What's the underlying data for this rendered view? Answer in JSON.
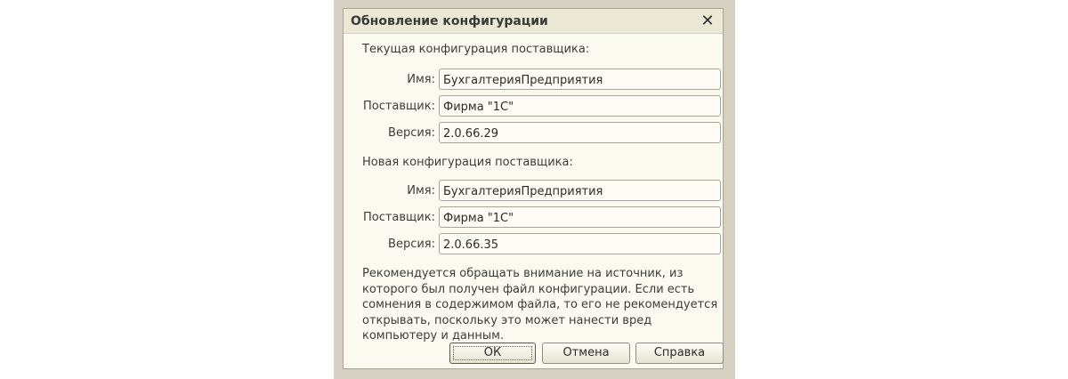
{
  "dialog": {
    "title": "Обновление конфигурации",
    "close_glyph": "✕"
  },
  "current": {
    "heading": "Текущая конфигурация поставщика:",
    "name_label": "Имя:",
    "name_value": "БухгалтерияПредприятия",
    "vendor_label": "Поставщик:",
    "vendor_value": "Фирма \"1С\"",
    "version_label": "Версия:",
    "version_value": "2.0.66.29"
  },
  "new": {
    "heading": "Новая конфигурация поставщика:",
    "name_label": "Имя:",
    "name_value": "БухгалтерияПредприятия",
    "vendor_label": "Поставщик:",
    "vendor_value": "Фирма \"1С\"",
    "version_label": "Версия:",
    "version_value": "2.0.66.35"
  },
  "note": {
    "text": "Рекомендуется обращать внимание на источник, из которого был получен файл конфигурации. Если есть сомнения в содержимом файла, то его не рекомендуется открывать, поскольку это может нанести вред компьютеру и данным."
  },
  "buttons": {
    "ok": "ОК",
    "cancel": "Отмена",
    "help": "Справка"
  }
}
